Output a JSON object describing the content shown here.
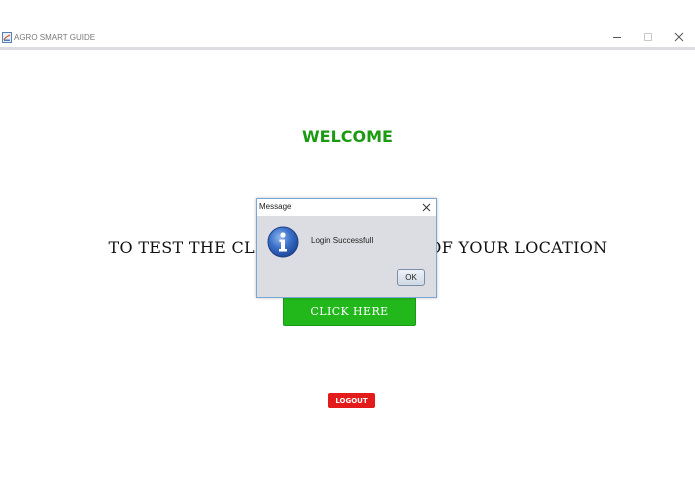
{
  "window": {
    "title": "AGRO SMART GUIDE",
    "icons": {
      "app": "java-app-icon",
      "minimize": "minimize-icon",
      "maximize": "maximize-icon",
      "close": "close-icon"
    }
  },
  "main": {
    "welcome": "WELCOME",
    "instruction": "TO TEST THE CLIMATE CONDITION OF YOUR LOCATION",
    "click_button": "CLICK HERE",
    "logout_button": "LOGOUT"
  },
  "dialog": {
    "title": "Message",
    "message": "Login Successfull",
    "ok_button": "OK",
    "icon": "info-icon"
  },
  "colors": {
    "welcome": "#1b9a12",
    "click_button": "#22b81c",
    "logout_button": "#e31b1b",
    "dialog_bg": "#dcdde2",
    "dialog_border": "#7aa7d3"
  }
}
